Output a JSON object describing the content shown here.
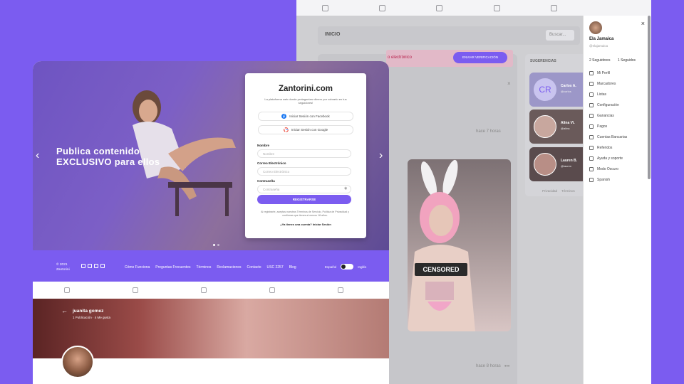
{
  "background_app": {
    "header": {
      "title": "INICIO",
      "search_placeholder": "Buscar..."
    },
    "alert": {
      "text": "o electrónico",
      "button": "ENVIAR VERIFICACIÓN"
    },
    "feed": {
      "time_top": "hace 7 horas",
      "time_bottom": "hace 8 horas"
    },
    "post_badge": "CENSORED",
    "suggestions": {
      "title": "SUGERENCIAS",
      "cards": [
        {
          "initials": "CR",
          "name": "Carlos A.",
          "handle": "@carlos"
        },
        {
          "initials": "",
          "name": "Alina Vi.",
          "handle": "@alina"
        },
        {
          "initials": "",
          "name": "Lauren B.",
          "handle": "@lauren"
        }
      ],
      "footer_links": [
        "Privacidad",
        "Términos"
      ]
    }
  },
  "user_menu": {
    "name": "Ela Jamaica",
    "handle": "@elajamaica",
    "followers": "2 Seguidores",
    "following": "1 Seguidos",
    "items": [
      "Mi Perfil",
      "Marcadores",
      "Listas",
      "Configuración",
      "Ganancias",
      "Pagos",
      "Cuentas Bancarias",
      "Referidos",
      "Ayuda y soporte",
      "Modo Oscuro",
      "Spanish"
    ]
  },
  "hero": {
    "headline_1": "Publica contenido",
    "headline_2": "EXCLUSIVO para ellos"
  },
  "register": {
    "logo": "Zantorini.com",
    "description": "La plataforma web donde protagonizar dinero por cobrarlo en tus seguidores!",
    "facebook": "Iniciar Sesión con Facebook",
    "google": "Iniciar Sesión con Google",
    "name_label": "Nombre",
    "name_placeholder": "Nombre",
    "email_label": "Correo Electrónico",
    "email_placeholder": "Correo Electrónico",
    "password_label": "Contraseña",
    "password_placeholder": "Contraseña",
    "submit": "REGISTRARSE",
    "terms": "Al registrarte, aceptas nuestros Términos de Servicio, Política de Privacidad y confirmas que tienes al menos 18 años.",
    "login_link": "¿Ya tienes una cuenta? Iniciar Sesión"
  },
  "footer": {
    "copyright_1": "© 2021",
    "copyright_2": "Zantorini",
    "links": [
      "Cómo Funciona",
      "Preguntas Frecuentes",
      "Términos",
      "Reclamaciones",
      "Contacto",
      "USC 2257",
      "Blog"
    ],
    "lang_left": "Español",
    "lang_right": "Inglés"
  },
  "profile": {
    "name": "juanita gomez",
    "stats": "1 Publicación  ·  4 Me gusta"
  },
  "colors": {
    "accent": "#7b5cf0",
    "alert_text": "#b8244e"
  }
}
